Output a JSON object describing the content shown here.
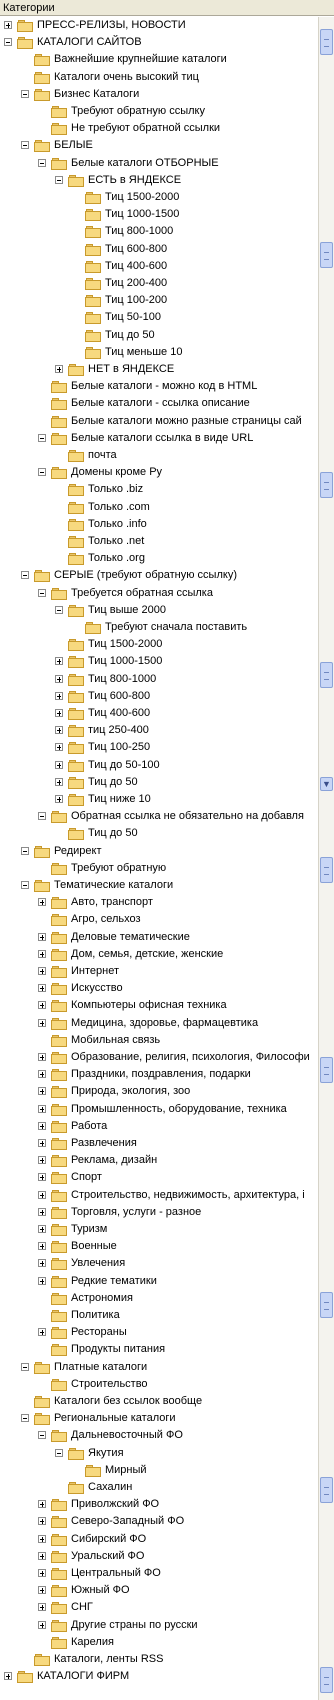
{
  "header": {
    "title": "Категории"
  },
  "icons": {
    "folder": "folder-icon",
    "expand": "expander-icon"
  },
  "rows": [
    {
      "d": 0,
      "e": "plus",
      "t": "ПРЕСС-РЕЛИЗЫ, НОВОСТИ"
    },
    {
      "d": 0,
      "e": "minus",
      "t": "КАТАЛОГИ САЙТОВ"
    },
    {
      "d": 1,
      "e": "",
      "t": "Важнейшие крупнейшие каталоги"
    },
    {
      "d": 1,
      "e": "",
      "t": "Каталоги очень высокий тиц"
    },
    {
      "d": 1,
      "e": "minus",
      "t": "Бизнес Каталоги"
    },
    {
      "d": 2,
      "e": "",
      "t": "Требуют обратную ссылку"
    },
    {
      "d": 2,
      "e": "",
      "t": "Не требуют обратной ссылки"
    },
    {
      "d": 1,
      "e": "minus",
      "t": "БЕЛЫЕ"
    },
    {
      "d": 2,
      "e": "minus",
      "t": "Белые каталоги ОТБОРНЫЕ"
    },
    {
      "d": 3,
      "e": "minus",
      "t": "ЕСТЬ в ЯНДЕКСЕ"
    },
    {
      "d": 4,
      "e": "",
      "t": "Тиц 1500-2000"
    },
    {
      "d": 4,
      "e": "",
      "t": "Тиц 1000-1500"
    },
    {
      "d": 4,
      "e": "",
      "t": "Тиц 800-1000"
    },
    {
      "d": 4,
      "e": "",
      "t": "Тиц 600-800"
    },
    {
      "d": 4,
      "e": "",
      "t": "Тиц 400-600"
    },
    {
      "d": 4,
      "e": "",
      "t": "Тиц 200-400"
    },
    {
      "d": 4,
      "e": "",
      "t": "Тиц 100-200"
    },
    {
      "d": 4,
      "e": "",
      "t": "Тиц 50-100"
    },
    {
      "d": 4,
      "e": "",
      "t": "Тиц до 50"
    },
    {
      "d": 4,
      "e": "",
      "t": "Тиц меньше 10"
    },
    {
      "d": 3,
      "e": "plus",
      "t": "НЕТ в ЯНДЕКСЕ"
    },
    {
      "d": 2,
      "e": "",
      "t": "Белые каталоги - можно код в HTML"
    },
    {
      "d": 2,
      "e": "",
      "t": "Белые каталоги - ссылка описание"
    },
    {
      "d": 2,
      "e": "",
      "t": "Белые каталоги можно разные страницы сай"
    },
    {
      "d": 2,
      "e": "minus",
      "t": "Белые каталоги ссылка в виде URL"
    },
    {
      "d": 3,
      "e": "",
      "t": "почта"
    },
    {
      "d": 2,
      "e": "minus",
      "t": "Домены кроме Ру"
    },
    {
      "d": 3,
      "e": "",
      "t": "Только .biz"
    },
    {
      "d": 3,
      "e": "",
      "t": "Только .com"
    },
    {
      "d": 3,
      "e": "",
      "t": "Только .info"
    },
    {
      "d": 3,
      "e": "",
      "t": "Только .net"
    },
    {
      "d": 3,
      "e": "",
      "t": "Только .org"
    },
    {
      "d": 1,
      "e": "minus",
      "t": "СЕРЫЕ (требуют обратную ссылку)"
    },
    {
      "d": 2,
      "e": "minus",
      "t": "Требуется обратная ссылка"
    },
    {
      "d": 3,
      "e": "minus",
      "t": "Тиц выше 2000"
    },
    {
      "d": 4,
      "e": "",
      "t": "Требуют сначала поставить"
    },
    {
      "d": 3,
      "e": "",
      "t": "Тиц 1500-2000"
    },
    {
      "d": 3,
      "e": "plus",
      "t": "Тиц 1000-1500"
    },
    {
      "d": 3,
      "e": "plus",
      "t": "Тиц 800-1000"
    },
    {
      "d": 3,
      "e": "plus",
      "t": "Тиц 600-800"
    },
    {
      "d": 3,
      "e": "plus",
      "t": "Тиц 400-600"
    },
    {
      "d": 3,
      "e": "plus",
      "t": "тиц 250-400"
    },
    {
      "d": 3,
      "e": "plus",
      "t": "Тиц 100-250"
    },
    {
      "d": 3,
      "e": "plus",
      "t": "Тиц до 50-100"
    },
    {
      "d": 3,
      "e": "plus",
      "t": "Тиц до 50"
    },
    {
      "d": 3,
      "e": "plus",
      "t": "Тиц ниже 10"
    },
    {
      "d": 2,
      "e": "minus",
      "t": "Обратная ссылка не обязательно на добавля"
    },
    {
      "d": 3,
      "e": "",
      "t": "Тиц до 50"
    },
    {
      "d": 1,
      "e": "minus",
      "t": "Редирект"
    },
    {
      "d": 2,
      "e": "",
      "t": "Требуют обратную"
    },
    {
      "d": 1,
      "e": "minus",
      "t": "Тематические каталоги"
    },
    {
      "d": 2,
      "e": "plus",
      "t": "Авто, транспорт"
    },
    {
      "d": 2,
      "e": "",
      "t": "Агро, сельхоз"
    },
    {
      "d": 2,
      "e": "plus",
      "t": "Деловые тематические"
    },
    {
      "d": 2,
      "e": "plus",
      "t": "Дом, семья, детские, женские"
    },
    {
      "d": 2,
      "e": "plus",
      "t": "Интернет"
    },
    {
      "d": 2,
      "e": "plus",
      "t": "Искусство"
    },
    {
      "d": 2,
      "e": "plus",
      "t": "Компьютеры офисная техника"
    },
    {
      "d": 2,
      "e": "plus",
      "t": "Медицина, здоровье, фармацевтика"
    },
    {
      "d": 2,
      "e": "",
      "t": "Мобильная связь"
    },
    {
      "d": 2,
      "e": "plus",
      "t": "Образование, религия, психология, Философи"
    },
    {
      "d": 2,
      "e": "plus",
      "t": "Праздники, поздравления, подарки"
    },
    {
      "d": 2,
      "e": "plus",
      "t": "Природа, экология, зоо"
    },
    {
      "d": 2,
      "e": "plus",
      "t": "Промышленность, оборудование, техника"
    },
    {
      "d": 2,
      "e": "plus",
      "t": "Работа"
    },
    {
      "d": 2,
      "e": "plus",
      "t": "Развлечения"
    },
    {
      "d": 2,
      "e": "plus",
      "t": "Реклама, дизайн"
    },
    {
      "d": 2,
      "e": "plus",
      "t": "Спорт"
    },
    {
      "d": 2,
      "e": "plus",
      "t": "Строительство, недвижимость, архитектура, і"
    },
    {
      "d": 2,
      "e": "plus",
      "t": "Торговля, услуги - разное"
    },
    {
      "d": 2,
      "e": "plus",
      "t": "Туризм"
    },
    {
      "d": 2,
      "e": "plus",
      "t": "Военные"
    },
    {
      "d": 2,
      "e": "plus",
      "t": "Увлечения"
    },
    {
      "d": 2,
      "e": "plus",
      "t": "Редкие тематики"
    },
    {
      "d": 2,
      "e": "",
      "t": "Астрономия"
    },
    {
      "d": 2,
      "e": "",
      "t": "Политика"
    },
    {
      "d": 2,
      "e": "plus",
      "t": "Рестораны"
    },
    {
      "d": 2,
      "e": "",
      "t": "Продукты питания"
    },
    {
      "d": 1,
      "e": "minus",
      "t": "Платные каталоги"
    },
    {
      "d": 2,
      "e": "",
      "t": "Строительство"
    },
    {
      "d": 1,
      "e": "",
      "t": "Каталоги без ссылок вообще"
    },
    {
      "d": 1,
      "e": "minus",
      "t": "Региональные каталоги"
    },
    {
      "d": 2,
      "e": "minus",
      "t": "Дальневосточный ФО"
    },
    {
      "d": 3,
      "e": "minus",
      "t": "Якутия"
    },
    {
      "d": 4,
      "e": "",
      "t": "Мирный"
    },
    {
      "d": 3,
      "e": "",
      "t": "Сахалин"
    },
    {
      "d": 2,
      "e": "plus",
      "t": "Приволжский ФО"
    },
    {
      "d": 2,
      "e": "plus",
      "t": "Северо-Западный ФО"
    },
    {
      "d": 2,
      "e": "plus",
      "t": "Сибирский ФО"
    },
    {
      "d": 2,
      "e": "plus",
      "t": "Уральский ФО"
    },
    {
      "d": 2,
      "e": "plus",
      "t": "Центральный ФО"
    },
    {
      "d": 2,
      "e": "plus",
      "t": "Южный ФО"
    },
    {
      "d": 2,
      "e": "plus",
      "t": "СНГ"
    },
    {
      "d": 2,
      "e": "plus",
      "t": "Другие страны по русски"
    },
    {
      "d": 2,
      "e": "",
      "t": "Карелия"
    },
    {
      "d": 1,
      "e": "",
      "t": "Каталоги, ленты RSS"
    },
    {
      "d": 0,
      "e": "plus",
      "t": "КАТАЛОГИ ФИРМ"
    }
  ]
}
